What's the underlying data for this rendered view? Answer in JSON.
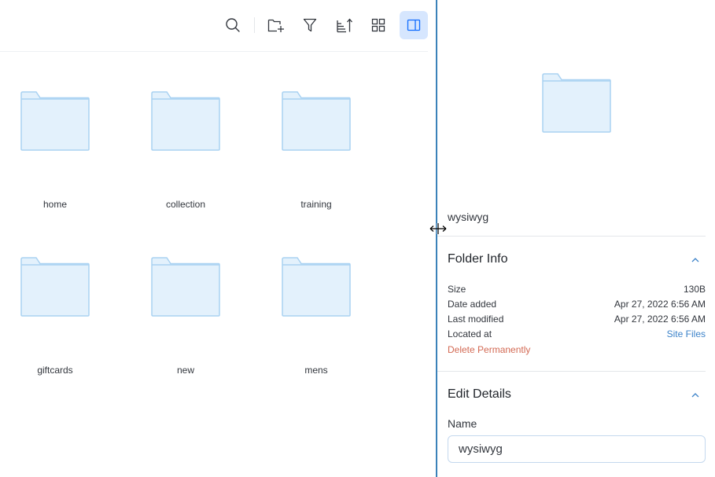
{
  "toolbar": {
    "buttons": [
      {
        "name": "search",
        "icon": "search-icon"
      },
      {
        "name": "new-folder",
        "icon": "folder-add-icon"
      },
      {
        "name": "filter",
        "icon": "filter-icon"
      },
      {
        "name": "sort",
        "icon": "sort-icon"
      },
      {
        "name": "grid-view",
        "icon": "grid-icon"
      },
      {
        "name": "toggle-panel",
        "icon": "side-panel-icon",
        "active": true
      }
    ]
  },
  "folders": [
    {
      "label": "home"
    },
    {
      "label": "collection"
    },
    {
      "label": "training"
    },
    {
      "label": "giftcards"
    },
    {
      "label": "new"
    },
    {
      "label": "mens"
    }
  ],
  "panel": {
    "filename": "wysiwyg",
    "folder_info": {
      "title": "Folder Info",
      "rows": [
        {
          "key": "Size",
          "value": "130B"
        },
        {
          "key": "Date added",
          "value": "Apr 27, 2022 6:56 AM"
        },
        {
          "key": "Last modified",
          "value": "Apr 27, 2022 6:56 AM"
        },
        {
          "key": "Located at",
          "value": "Site Files"
        }
      ],
      "delete_label": "Delete Permanently"
    },
    "edit_details": {
      "title": "Edit Details",
      "name_label": "Name",
      "name_value": "wysiwyg"
    }
  },
  "colors": {
    "accent": "#3b82c9",
    "splitter": "#3b82b9",
    "folder_fill": "#e3f1fc",
    "folder_stroke": "#a9d2f2",
    "danger": "#d36a54",
    "active_button_bg": "#d6e6fe"
  }
}
